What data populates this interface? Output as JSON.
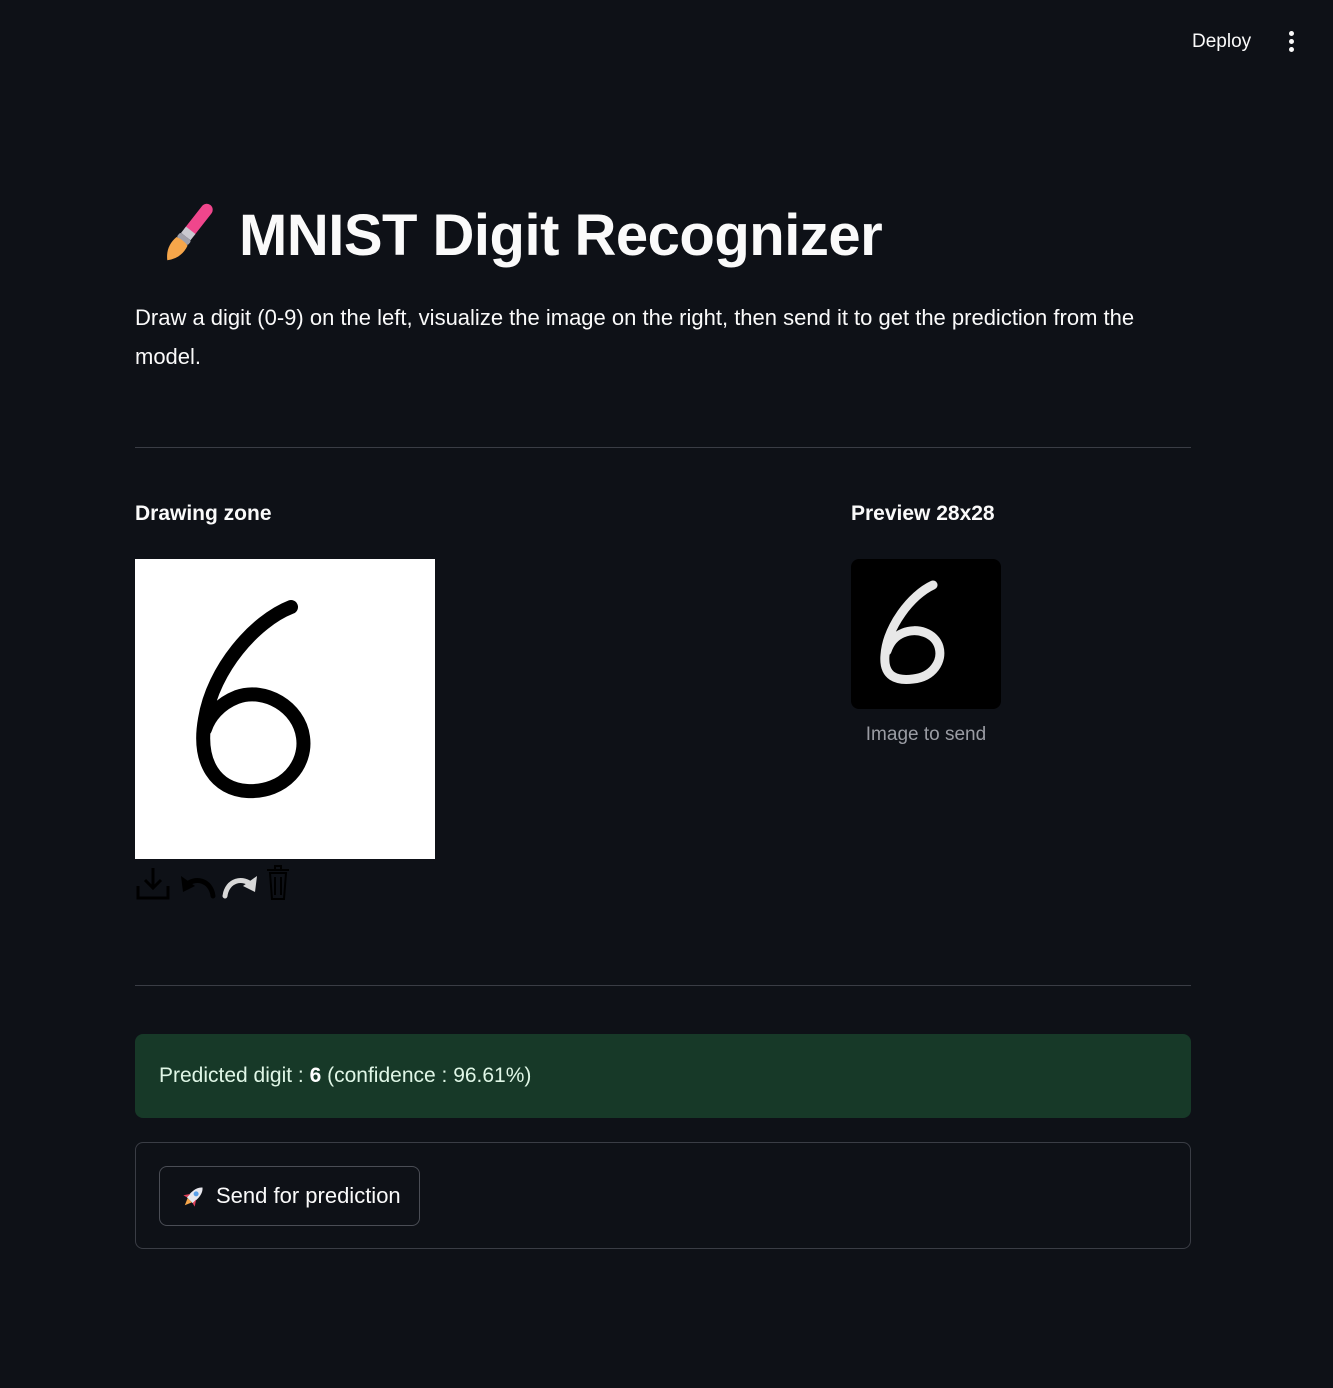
{
  "header": {
    "deploy_label": "Deploy",
    "menu_icon": "kebab-menu-icon"
  },
  "main": {
    "title_icon": "paintbrush-icon",
    "title": "MNIST Digit Recognizer",
    "description": "Draw a digit (0-9) on the left, visualize the image on the right, then send it to get the prediction from the model.",
    "drawing": {
      "heading": "Drawing zone",
      "drawn_digit": "6",
      "toolbar": [
        "download-icon",
        "undo-icon",
        "redo-icon",
        "trash-icon"
      ]
    },
    "preview": {
      "heading": "Preview 28x28",
      "caption": "Image to send"
    },
    "result": {
      "prefix": "Predicted digit : ",
      "digit": "6",
      "suffix": " (confidence : 96.61%)"
    },
    "send_button": {
      "icon": "rocket-icon",
      "label": "Send for prediction"
    }
  },
  "colors": {
    "background": "#0e1117",
    "text": "#fafafa",
    "success_bg": "#173928",
    "brush_pink": "#f0468c"
  }
}
